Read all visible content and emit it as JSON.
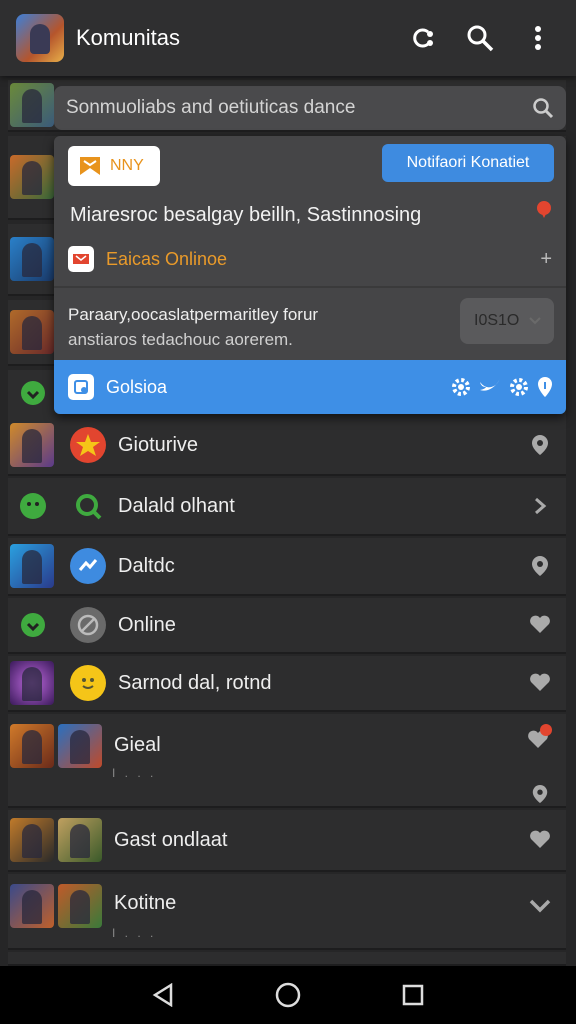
{
  "app": {
    "title": "Komunitas"
  },
  "search": {
    "placeholder": "Sonmuoliabs and oetiuticas dance"
  },
  "card": {
    "badge_label": "NNY",
    "notification_button": "Notifaori Konatiet",
    "headline": "Miaresroc besalgay beilln, Sastinnosing",
    "online_label": "Eaicas Onlinoe",
    "paragraph_line1": "Paraary,oocaslatpermaritley forur",
    "paragraph_line2": "anstiaros tedachouc aorerem.",
    "toggle_value": "I0S1O",
    "action_label": "Golsioa"
  },
  "rows": [
    {
      "label": "Gioturive"
    },
    {
      "label": "Dalald olhant"
    },
    {
      "label": "Daltdc"
    },
    {
      "label": "Online"
    },
    {
      "label": "Sarnod dal, rotnd"
    },
    {
      "label": "Gieal",
      "sub": "I . . ."
    },
    {
      "label": "Gast ondlaat"
    },
    {
      "label": "Kotitne",
      "sub": "I . . ."
    }
  ],
  "colors": {
    "accent": "#3e8fe6",
    "orange": "#e8931c",
    "red": "#e2452f",
    "green": "#3faa3f"
  }
}
